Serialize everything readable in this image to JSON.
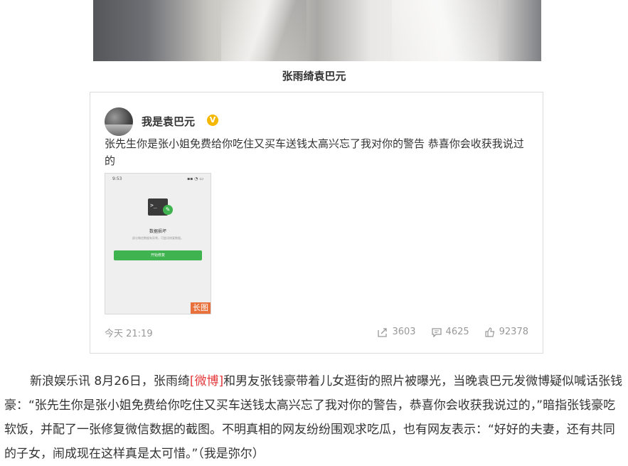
{
  "photo": {
    "caption": "张雨绮袁巴元"
  },
  "weibo_card": {
    "username": "我是袁巴元",
    "verified_badge": "V",
    "text": "张先生你是张小姐免费给你吃住又买车送钱太高兴忘了我对你的警告 恭喜你会收获我说过的",
    "image": {
      "status_time": "9:53",
      "status_right": "▪▪ ◔ ▭",
      "title": "数据损坏",
      "desc": "部分微信数据有异常，可尝试修复数据。",
      "button": "开始修复",
      "badge": "长图"
    },
    "time": "今天 21:19",
    "shares": "3603",
    "comments": "4625",
    "likes": "92378"
  },
  "article": {
    "lead": "新浪娱乐讯 8月26日，张雨绮",
    "link": "[微博]",
    "rest": "和男友张钱豪带着儿女逛街的照片被曝光，当晚袁巴元发微博疑似喊话张钱豪：“张先生你是张小姐免费给你吃住又买车送钱太高兴忘了我对你的警告，恭喜你会收获我说过的，”暗指张钱豪吃软饭，并配了一张修复微信数据的截图。不明真相的网友纷纷围观求吃瓜，也有网友表示：“好好的夫妻，还有共同的子女，闹成现在这样真是太可惜。”（我是弥尔）"
  },
  "colors": {
    "accent_red": "#e4393c",
    "verified": "#f5b800",
    "wechat_green": "#3fb34f",
    "badge_orange": "#e8703a"
  }
}
